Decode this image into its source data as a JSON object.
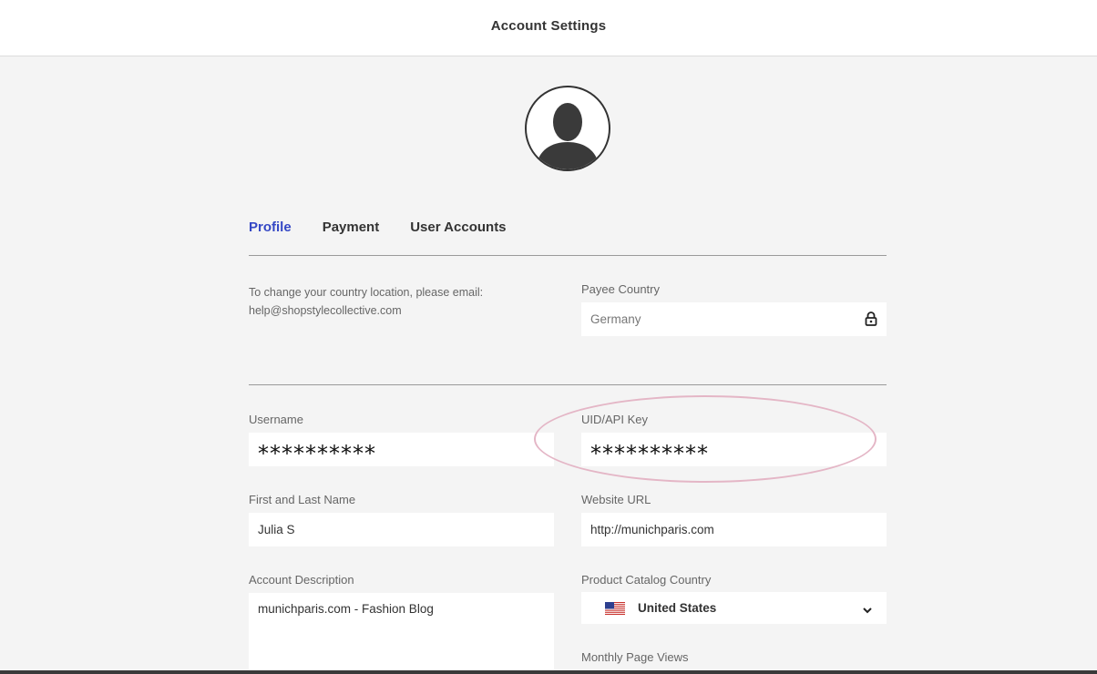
{
  "header": {
    "title": "Account Settings"
  },
  "avatar": {
    "icon": "user-silhouette-icon"
  },
  "tabs": [
    {
      "label": "Profile",
      "active": true
    },
    {
      "label": "Payment",
      "active": false
    },
    {
      "label": "User Accounts",
      "active": false
    }
  ],
  "colors": {
    "accent": "#3447c5",
    "annotation": "#e4b6c6"
  },
  "country_note": "To change your country location, please email: help@shopstylecollective.com",
  "payee_country": {
    "label": "Payee Country",
    "value": "Germany",
    "icon": "lock-icon"
  },
  "username": {
    "label": "Username",
    "value": "**********"
  },
  "api_key": {
    "label": "UID/API Key",
    "value": "**********"
  },
  "name": {
    "label": "First and Last Name",
    "value": "Julia S"
  },
  "website": {
    "label": "Website URL",
    "value": "http://munichparis.com"
  },
  "description": {
    "label": "Account Description",
    "value": "munichparis.com - Fashion Blog"
  },
  "catalog_country": {
    "label": "Product Catalog Country",
    "value": "United States",
    "icon": "us-flag-icon"
  },
  "monthly_views": {
    "label": "Monthly Page Views"
  }
}
